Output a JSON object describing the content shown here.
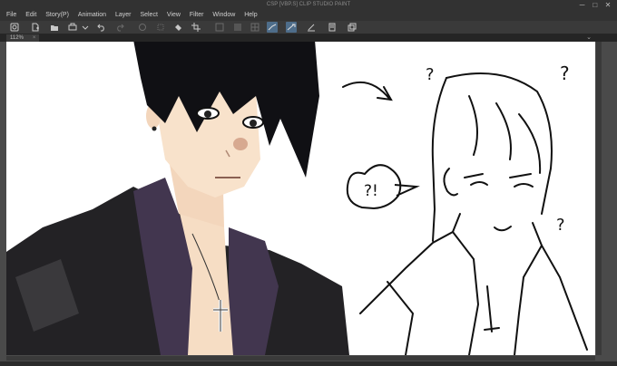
{
  "window": {
    "title": "CSP [VBP.S] CLIP STUDIO PAINT",
    "controls": [
      "─",
      "□",
      "✕"
    ]
  },
  "menu": [
    "File",
    "Edit",
    "Story(P)",
    "Animation",
    "Layer",
    "Select",
    "View",
    "Filter",
    "Window",
    "Help"
  ],
  "document_tab": {
    "label": "112%",
    "close": "×"
  },
  "tab_menu_icon": "⌄",
  "toolbar_icons": [
    "clip-studio-icon",
    "new-icon",
    "open-icon",
    "save-icon",
    "dropdown-icon",
    "undo-icon",
    "redo-icon",
    "clear-icon",
    "transform-icon",
    "fill-icon",
    "crop-icon",
    "layer-icon",
    "selection-icon",
    "snap-ruler-icon",
    "snap-special-ruler-icon",
    "snap-grid-icon",
    "show-canvas-icon",
    "layer-settings-icon"
  ],
  "colors": {
    "chrome": "#323232",
    "toolbar": "#3a3a3a",
    "workspace": "#4a4a4a",
    "active_tool": "#4e6d8a",
    "canvas": "#ffffff"
  },
  "artwork": {
    "speech_bubble_text": "?!",
    "question_marks": [
      "?",
      "?",
      "?"
    ]
  }
}
